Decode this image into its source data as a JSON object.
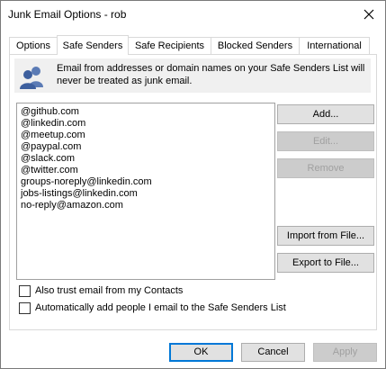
{
  "window": {
    "title": "Junk Email Options - rob"
  },
  "tabs": [
    {
      "label": "Options"
    },
    {
      "label": "Safe Senders"
    },
    {
      "label": "Safe Recipients"
    },
    {
      "label": "Blocked Senders"
    },
    {
      "label": "International"
    }
  ],
  "active_tab": "Safe Senders",
  "info": {
    "text": "Email from addresses or domain names on your Safe Senders List will never be treated as junk email."
  },
  "safe_senders": [
    "@github.com",
    "@linkedin.com",
    "@meetup.com",
    "@paypal.com",
    "@slack.com",
    "@twitter.com",
    "groups-noreply@linkedin.com",
    "jobs-listings@linkedin.com",
    "no-reply@amazon.com"
  ],
  "buttons": {
    "add": "Add...",
    "edit": "Edit...",
    "remove": "Remove",
    "import": "Import from File...",
    "export": "Export to File..."
  },
  "checkboxes": {
    "trust_contacts": {
      "label": "Also trust email from my Contacts",
      "checked": false
    },
    "auto_add": {
      "label": "Automatically add people I email to the Safe Senders List",
      "checked": false
    }
  },
  "footer": {
    "ok": "OK",
    "cancel": "Cancel",
    "apply": "Apply"
  },
  "icons": {
    "close": "close-icon",
    "people": "people-icon"
  },
  "colors": {
    "accent": "#0078d7",
    "disabled_text": "#a0a0a0"
  }
}
